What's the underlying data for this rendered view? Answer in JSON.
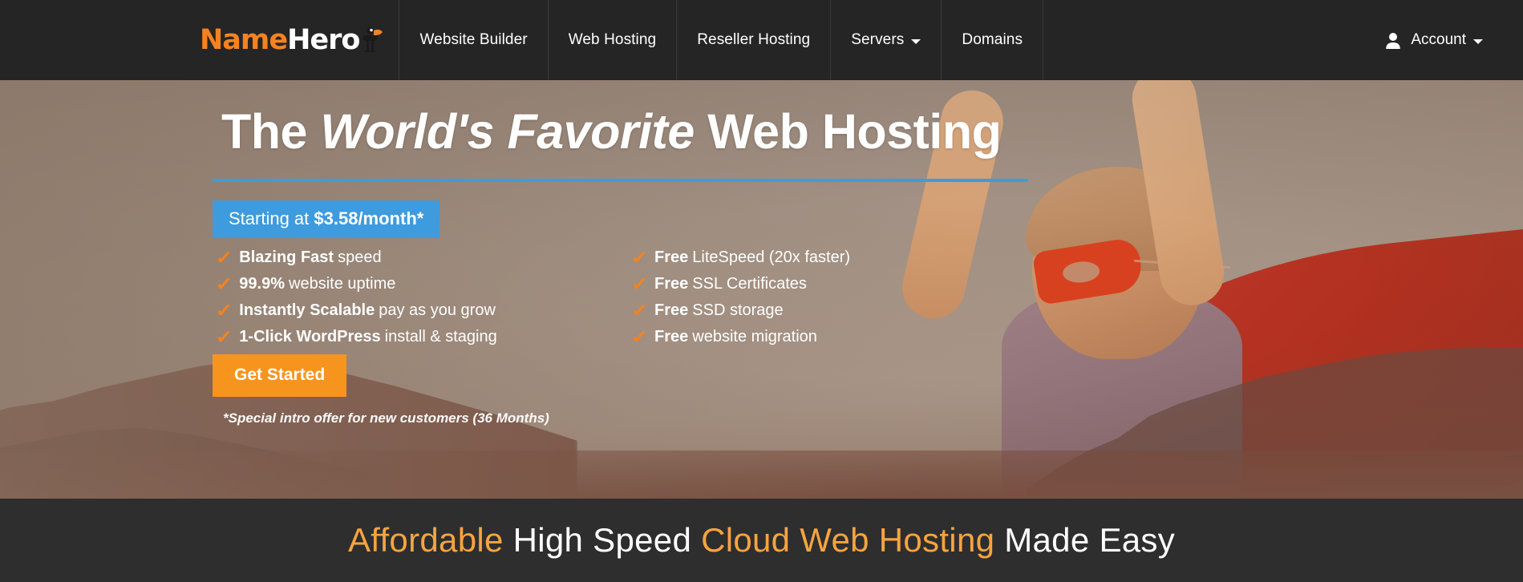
{
  "navbar": {
    "background_color": "#252525",
    "logo": {
      "name_part": "Name",
      "hero_part": "Hero",
      "name_color": "#f58220",
      "hero_color": "#ffffff",
      "mark": "superhero-mascot-icon"
    },
    "items": [
      {
        "label": "Website Builder",
        "has_caret": false
      },
      {
        "label": "Web Hosting",
        "has_caret": false
      },
      {
        "label": "Reseller Hosting",
        "has_caret": false
      },
      {
        "label": "Servers",
        "has_caret": true
      },
      {
        "label": "Domains",
        "has_caret": false
      }
    ],
    "account": {
      "label": "Account",
      "icon": "user-icon",
      "has_caret": true
    }
  },
  "hero": {
    "headline": {
      "before": "The ",
      "emphasis": "World's Favorite",
      "after": " Web Hosting"
    },
    "rule_color": "#3e9bdd",
    "price_badge": {
      "prefix": "Starting at ",
      "price": "$3.58/month*",
      "background_color": "#3e9bdd"
    },
    "features_left": [
      {
        "bold": "Blazing Fast",
        "rest": " speed"
      },
      {
        "bold": "99.9%",
        "rest": " website uptime"
      },
      {
        "bold": "Instantly Scalable",
        "rest": " pay as you grow"
      },
      {
        "bold": "1-Click WordPress",
        "rest": " install & staging"
      }
    ],
    "features_right": [
      {
        "bold": "Free",
        "rest": " LiteSpeed (20x faster)"
      },
      {
        "bold": "Free",
        "rest": " SSL Certificates"
      },
      {
        "bold": "Free",
        "rest": " SSD storage"
      },
      {
        "bold": "Free",
        "rest": " website migration"
      }
    ],
    "check_icon_color": "#f58220",
    "cta_label": "Get Started",
    "cta_color": "#f7941e",
    "disclaimer": "*Special intro offer for new customers (36 Months)"
  },
  "bottom_bar": {
    "background_color": "#2e2e2e",
    "accent_color": "#f7a440",
    "tagline": {
      "part1": "Affordable",
      "part2": " High Speed ",
      "part3": "Cloud Web Hosting",
      "part4": " Made Easy"
    }
  }
}
